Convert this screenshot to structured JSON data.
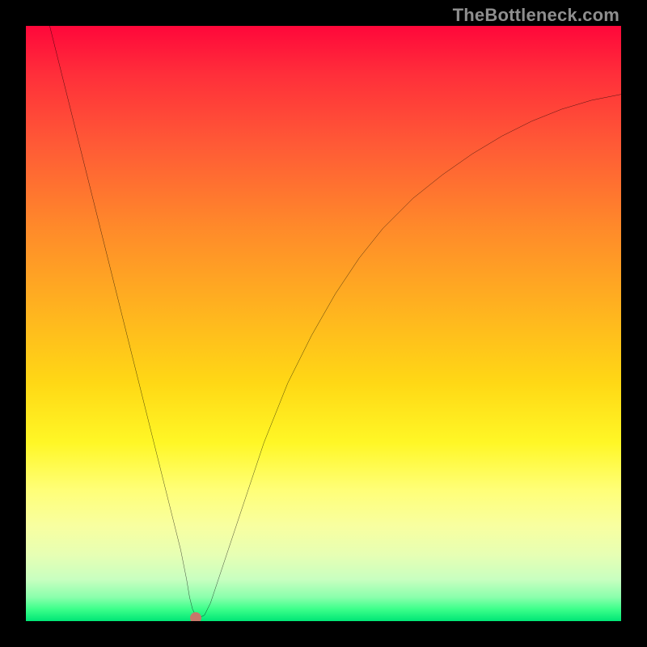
{
  "watermark": "TheBottleneck.com",
  "chart_data": {
    "type": "line",
    "title": "",
    "xlabel": "",
    "ylabel": "",
    "xlim": [
      0,
      100
    ],
    "ylim": [
      0,
      100
    ],
    "grid": false,
    "legend": false,
    "background_gradient": {
      "orientation": "vertical",
      "stops": [
        {
          "pos": 0.0,
          "color": "#ff073a"
        },
        {
          "pos": 0.5,
          "color": "#ffd815"
        },
        {
          "pos": 0.8,
          "color": "#ffff78"
        },
        {
          "pos": 1.0,
          "color": "#00e676"
        }
      ]
    },
    "series": [
      {
        "name": "bottleneck-curve",
        "color": "#000000",
        "x": [
          4,
          6,
          8,
          10,
          12,
          14,
          16,
          18,
          20,
          22,
          24,
          26,
          27,
          27.5,
          28,
          28.5,
          29,
          30,
          31,
          32,
          34,
          36,
          38,
          40,
          44,
          48,
          52,
          56,
          60,
          65,
          70,
          75,
          80,
          85,
          90,
          95,
          100
        ],
        "y": [
          100,
          92,
          84,
          76,
          68,
          60,
          52,
          44,
          36,
          28,
          20,
          12,
          7,
          4,
          2,
          1,
          0.5,
          1,
          3,
          6,
          12,
          18,
          24,
          30,
          40,
          48,
          55,
          61,
          66,
          71,
          75,
          78.5,
          81.5,
          84,
          86,
          87.5,
          88.5
        ]
      }
    ],
    "marker": {
      "x": 28.5,
      "y": 0.5,
      "color": "#c8786a"
    }
  }
}
